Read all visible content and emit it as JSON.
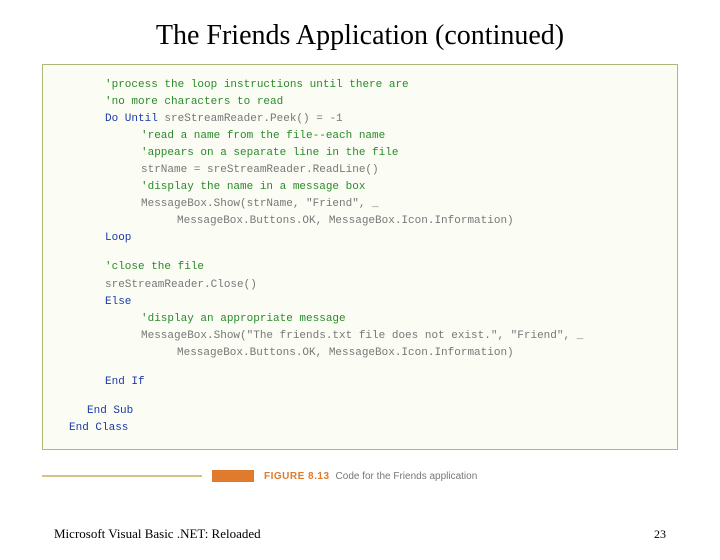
{
  "title": "The Friends Application (continued)",
  "code": {
    "c1": "'process the loop instructions until there are",
    "c2": "'no more characters to read",
    "doUntil_kw": "Do Until",
    "doUntil_rest": " sreStreamReader.Peek() = -1",
    "c3": "'read a name from the file--each name",
    "c4": "'appears on a separate line in the file",
    "readLine": "strName = sreStreamReader.ReadLine()",
    "c5": "'display the name in a message box",
    "msg1a": "MessageBox.Show(strName, \"Friend\", _",
    "msg1b": "MessageBox.Buttons.OK, MessageBox.Icon.Information)",
    "loop": "Loop",
    "c6": "'close the file",
    "closeLine": "sreStreamReader.Close()",
    "else_kw": "Else",
    "c7": "'display an appropriate message",
    "msg2a": "MessageBox.Show(\"The friends.txt file does not exist.\", \"Friend\", _",
    "msg2b": "MessageBox.Buttons.OK, MessageBox.Icon.Information)",
    "endIf": "End If",
    "endSub": "End Sub",
    "endClass": "End Class"
  },
  "caption": {
    "label": "FIGURE 8.13",
    "text": "Code for the Friends application"
  },
  "footer": {
    "left": "Microsoft Visual Basic .NET: Reloaded",
    "page": "23"
  }
}
